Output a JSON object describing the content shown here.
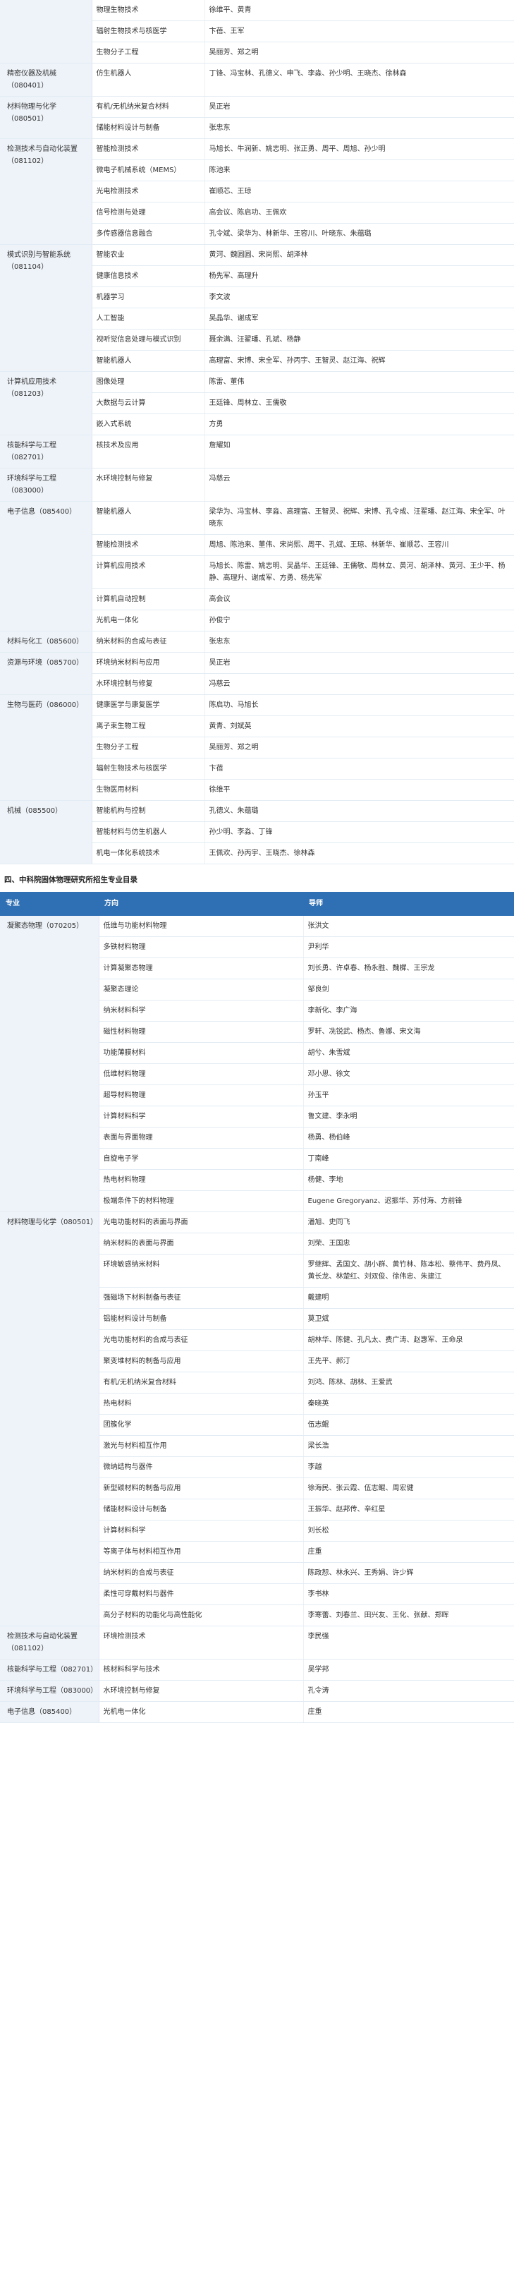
{
  "table1": {
    "groups": [
      {
        "major": "",
        "rows": [
          {
            "direction": "物理生物技术",
            "tutors": "徐维平、黄青"
          },
          {
            "direction": "辐射生物技术与核医学",
            "tutors": "卞蓓、王军"
          },
          {
            "direction": "生物分子工程",
            "tutors": "吴丽芳、郑之明"
          }
        ]
      },
      {
        "major": "精密仪器及机械（080401）",
        "rows": [
          {
            "direction": "仿生机器人",
            "tutors": "丁锋、冯宝林、孔德义、申飞、李淼、孙少明、王晓杰、徐林森"
          }
        ]
      },
      {
        "major": "材料物理与化学（080501）",
        "rows": [
          {
            "direction": "有机/无机纳米复合材料",
            "tutors": "吴正岩"
          },
          {
            "direction": "储能材料设计与制备",
            "tutors": "张忠东"
          }
        ]
      },
      {
        "major": "检测技术与自动化装置（081102）",
        "rows": [
          {
            "direction": "智能检测技术",
            "tutors": "马旭长、牛润新、姚志明、张正勇、周平、周旭、孙少明"
          },
          {
            "direction": "微电子机械系统（MEMS）",
            "tutors": "陈池来"
          },
          {
            "direction": "光电检测技术",
            "tutors": "崔顺芯、王琼"
          },
          {
            "direction": "信号检测与处理",
            "tutors": "高会议、陈启功、王佩欢"
          },
          {
            "direction": "多传感器信息融合",
            "tutors": "孔令斌、梁华为、林新华、王容川、叶晓东、朱蕴璐"
          }
        ]
      },
      {
        "major": "模式识别与智能系统（081104）",
        "rows": [
          {
            "direction": "智能农业",
            "tutors": "黄河、魏圆圆、宋尚熙、胡泽林"
          },
          {
            "direction": "健康信息技术",
            "tutors": "杨先军、高理升"
          },
          {
            "direction": "机器学习",
            "tutors": "李文波"
          },
          {
            "direction": "人工智能",
            "tutors": "吴晶华、谢成军"
          },
          {
            "direction": "视听觉信息处理与模式识别",
            "tutors": "聂余满、汪翟璠、孔斌、杨静"
          },
          {
            "direction": "智能机器人",
            "tutors": "高理富、宋博、宋全军、孙丙宇、王智灵、赵江海、祝辉"
          }
        ]
      },
      {
        "major": "计算机应用技术（081203）",
        "rows": [
          {
            "direction": "图像处理",
            "tutors": "陈雷、董伟"
          },
          {
            "direction": "大数据与云计算",
            "tutors": "王廷锋、周林立、王儒敬"
          },
          {
            "direction": "嵌入式系统",
            "tutors": "方勇"
          }
        ]
      },
      {
        "major": "核能科学与工程（082701）",
        "rows": [
          {
            "direction": "核技术及应用",
            "tutors": "詹耀如"
          }
        ]
      },
      {
        "major": "环境科学与工程（083000）",
        "rows": [
          {
            "direction": "水环境控制与修复",
            "tutors": "冯慈云"
          }
        ]
      },
      {
        "major": "电子信息（085400）",
        "rows": [
          {
            "direction": "智能机器人",
            "tutors": "梁华为、冯宝林、李淼、高理富、王智灵、祝辉、宋博、孔令成、汪翟璠、赵江海、宋全军、叶晓东"
          },
          {
            "direction": "智能检测技术",
            "tutors": "周旭、陈池来、董伟、宋尚熙、周平、孔斌、王琼、林新华、崔顺芯、王容川"
          },
          {
            "direction": "计算机应用技术",
            "tutors": "马旭长、陈雷、姚志明、吴晶华、王廷锋、王儒敬、周林立、黄河、胡泽林、黄河、王少平、杨静、高理升、谢成军、方勇、杨先军"
          },
          {
            "direction": "计算机自动控制",
            "tutors": "高会议"
          },
          {
            "direction": "光机电一体化",
            "tutors": "孙俊宁"
          }
        ]
      },
      {
        "major": "材料与化工（085600）",
        "rows": [
          {
            "direction": "纳米材料的合成与表征",
            "tutors": "张忠东"
          }
        ]
      },
      {
        "major": "资源与环境（085700）",
        "rows": [
          {
            "direction": "环境纳米材料与应用",
            "tutors": "吴正岩"
          },
          {
            "direction": "水环境控制与修复",
            "tutors": "冯慈云"
          }
        ]
      },
      {
        "major": "生物与医药（086000）",
        "rows": [
          {
            "direction": "健康医学与康复医学",
            "tutors": "陈启功、马旭长"
          },
          {
            "direction": "离子束生物工程",
            "tutors": "黄青、刘斌英"
          },
          {
            "direction": "生物分子工程",
            "tutors": "吴丽芳、郑之明"
          },
          {
            "direction": "辐射生物技术与核医学",
            "tutors": "卞蓓"
          },
          {
            "direction": "生物医用材料",
            "tutors": "徐维平"
          }
        ]
      },
      {
        "major": "机械（085500）",
        "rows": [
          {
            "direction": "智能机构与控制",
            "tutors": "孔德义、朱蕴璐"
          },
          {
            "direction": "智能材料与仿生机器人",
            "tutors": "孙少明、李淼、丁锋"
          },
          {
            "direction": "机电一体化系统技术",
            "tutors": "王佩欢、孙丙宇、王晓杰、徐林森"
          }
        ]
      }
    ]
  },
  "section_title": "四、中科院固体物理研究所招生专业目录",
  "table2": {
    "headers": {
      "major": "专业",
      "direction": "方向",
      "tutor": "导师"
    },
    "groups": [
      {
        "major": "凝聚态物理（070205）",
        "rows": [
          {
            "direction": "低维与功能材料物理",
            "tutors": "张洪文"
          },
          {
            "direction": "多铁材料物理",
            "tutors": "尹利华"
          },
          {
            "direction": "计算凝聚态物理",
            "tutors": "刘长勇、许卓春、杨永胜、魏樨、王宗龙"
          },
          {
            "direction": "凝聚态理论",
            "tutors": "邹良剑"
          },
          {
            "direction": "纳米材料科学",
            "tutors": "李新化、李广海"
          },
          {
            "direction": "磁性材料物理",
            "tutors": "罗轩、冼锐武、杨杰、鲁娜、宋文海"
          },
          {
            "direction": "功能薄膜材料",
            "tutors": "胡兮、朱雪斌"
          },
          {
            "direction": "低维材料物理",
            "tutors": "邓小思、徐文"
          },
          {
            "direction": "超导材料物理",
            "tutors": "孙玉平"
          },
          {
            "direction": "计算材料科学",
            "tutors": "鲁文建、李永明"
          },
          {
            "direction": "表面与界面物理",
            "tutors": "杨勇、杨伯峰"
          },
          {
            "direction": "自旋电子学",
            "tutors": "丁南峰"
          },
          {
            "direction": "热电材料物理",
            "tutors": "杨健、李地"
          },
          {
            "direction": "极端条件下的材料物理",
            "tutors": "Eugene Gregoryanz、迟振华、苏付海、方前锋"
          }
        ]
      },
      {
        "major": "材料物理与化学（080501）",
        "rows": [
          {
            "direction": "光电功能材料的表面与界面",
            "tutors": "潘旭、史同飞"
          },
          {
            "direction": "纳米材料的表面与界面",
            "tutors": "刘荣、王国忠"
          },
          {
            "direction": "环境敏感纳米材料",
            "tutors": "罗继辉、孟国文、胡小群、黄竹林、陈本松、蔡伟平、费丹凤、黄长龙、林楚红、刘双俊、徐伟忠、朱建江"
          },
          {
            "direction": "强磁场下材料制备与表征",
            "tutors": "戴建明"
          },
          {
            "direction": "铝能材料设计与制备",
            "tutors": "莫卫斌"
          },
          {
            "direction": "光电功能材料的合成与表征",
            "tutors": "胡林华、陈健、孔凡太、费广涛、赵惠军、王命泉"
          },
          {
            "direction": "聚变堆材料的制备与应用",
            "tutors": "王先平、郝汀"
          },
          {
            "direction": "有机/无机纳米复合材料",
            "tutors": "刘鸿、陈林、胡林、王爱武"
          },
          {
            "direction": "热电材料",
            "tutors": "秦晓英"
          },
          {
            "direction": "团簇化学",
            "tutors": "伍志鲲"
          },
          {
            "direction": "激光与材料相互作用",
            "tutors": "梁长浩"
          },
          {
            "direction": "微纳结构与器件",
            "tutors": "李越"
          },
          {
            "direction": "新型碳材料的制备与应用",
            "tutors": "徐海民、张云霞、伍志鲲、周宏健"
          },
          {
            "direction": "储能材料设计与制备",
            "tutors": "王振华、赵邦传、辛红星"
          },
          {
            "direction": "计算材料科学",
            "tutors": "刘长松"
          },
          {
            "direction": "等离子体与材料相互作用",
            "tutors": "庄重"
          },
          {
            "direction": "纳米材料的合成与表征",
            "tutors": "陈政恕、林永兴、王秀娟、许少辉"
          },
          {
            "direction": "柔性可穿戴材料与器件",
            "tutors": "李书林"
          },
          {
            "direction": "高分子材料的功能化与高性能化",
            "tutors": "李寒蕾、刘春兰、田兴友、王化、张献、郑晖"
          }
        ]
      },
      {
        "major": "检测技术与自动化装置（081102）",
        "rows": [
          {
            "direction": "环境检测技术",
            "tutors": "李民强"
          }
        ]
      },
      {
        "major": "核能科学与工程（082701）",
        "rows": [
          {
            "direction": "核材料科学与技术",
            "tutors": "吴学邦"
          }
        ]
      },
      {
        "major": "环境科学与工程（083000）",
        "rows": [
          {
            "direction": "水环境控制与修复",
            "tutors": "孔令涛"
          }
        ]
      },
      {
        "major": "电子信息（085400）",
        "rows": [
          {
            "direction": "光机电一体化",
            "tutors": "庄重"
          }
        ]
      }
    ]
  }
}
